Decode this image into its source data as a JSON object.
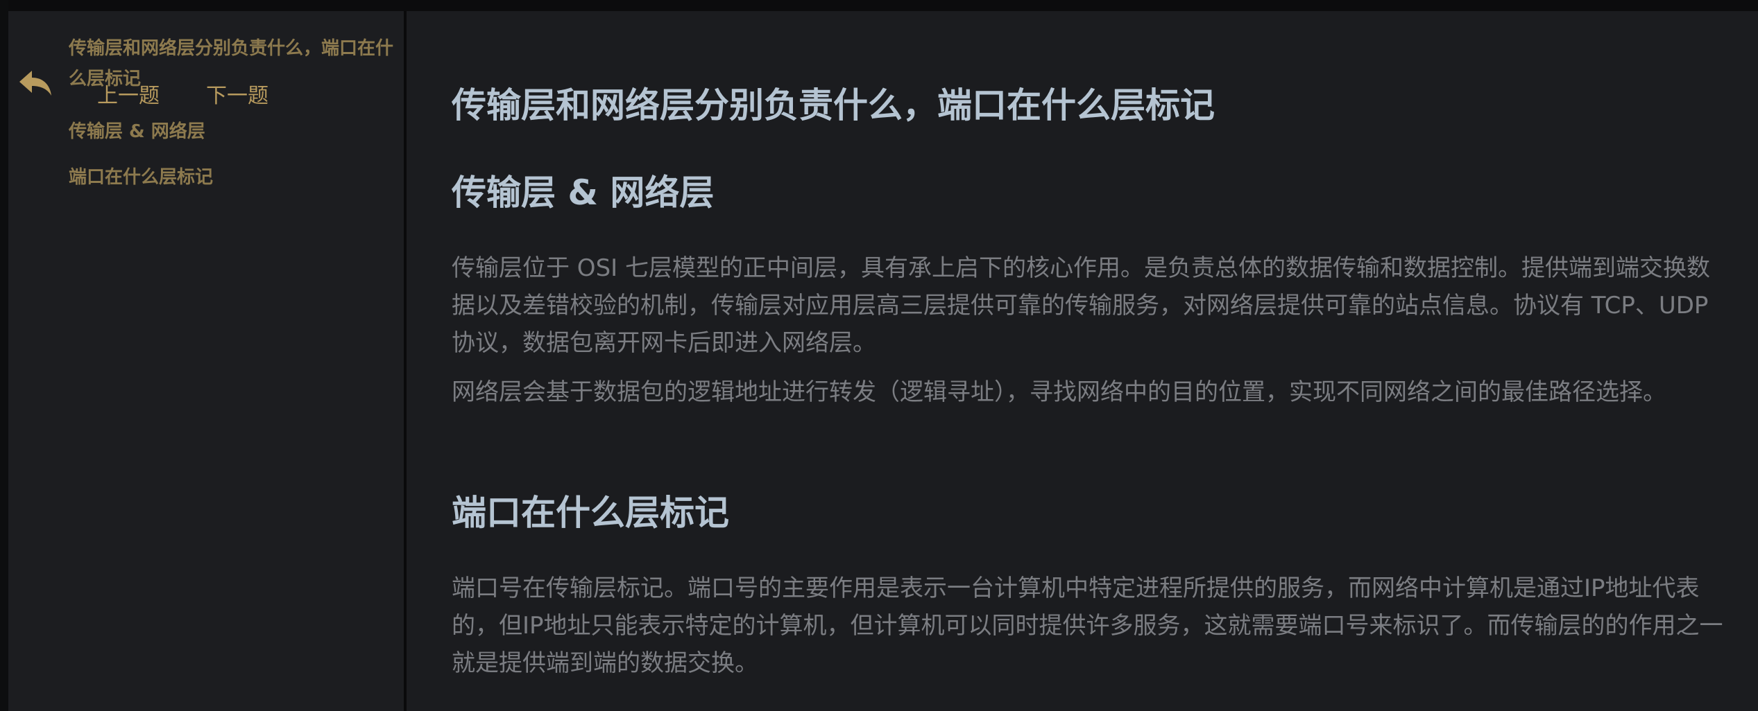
{
  "nav": {
    "prev_label": "上一题",
    "next_label": "下一题",
    "back_icon": "reply-arrow-icon"
  },
  "toc": {
    "items": [
      "传输层和网络层分别负责什么，端口在什么层标记",
      "传输层 & 网络层",
      "端口在什么层标记"
    ]
  },
  "article": {
    "title": "传输层和网络层分别负责什么，端口在什么层标记",
    "sections": [
      {
        "heading": "传输层 & 网络层",
        "paragraphs": [
          "传输层位于 OSI 七层模型的正中间层，具有承上启下的核心作用。是负责总体的数据传输和数据控制。提供端到端交换数据以及差错校验的机制，传输层对应用层高三层提供可靠的传输服务，对网络层提供可靠的站点信息。协议有 TCP、UDP 协议，数据包离开网卡后即进入网络层。",
          "网络层会基于数据包的逻辑地址进行转发（逻辑寻址），寻找网络中的目的位置，实现不同网络之间的最佳路径选择。"
        ]
      },
      {
        "heading": "端口在什么层标记",
        "paragraphs": [
          "端口号在传输层标记。端口号的主要作用是表示一台计算机中特定进程所提供的服务，而网络中计算机是通过IP地址代表的，但IP地址只能表示特定的计算机，但计算机可以同时提供许多服务，这就需要端口号来标识了。而传输层的的作用之一就是提供端到端的数据交换。"
        ]
      }
    ]
  },
  "colors": {
    "accent": "#b89b5e",
    "heading": "#b5c4d2",
    "body_text": "#7b7d82",
    "sidebar_bg": "#1c1d20",
    "content_bg": "#1b1c1f"
  }
}
